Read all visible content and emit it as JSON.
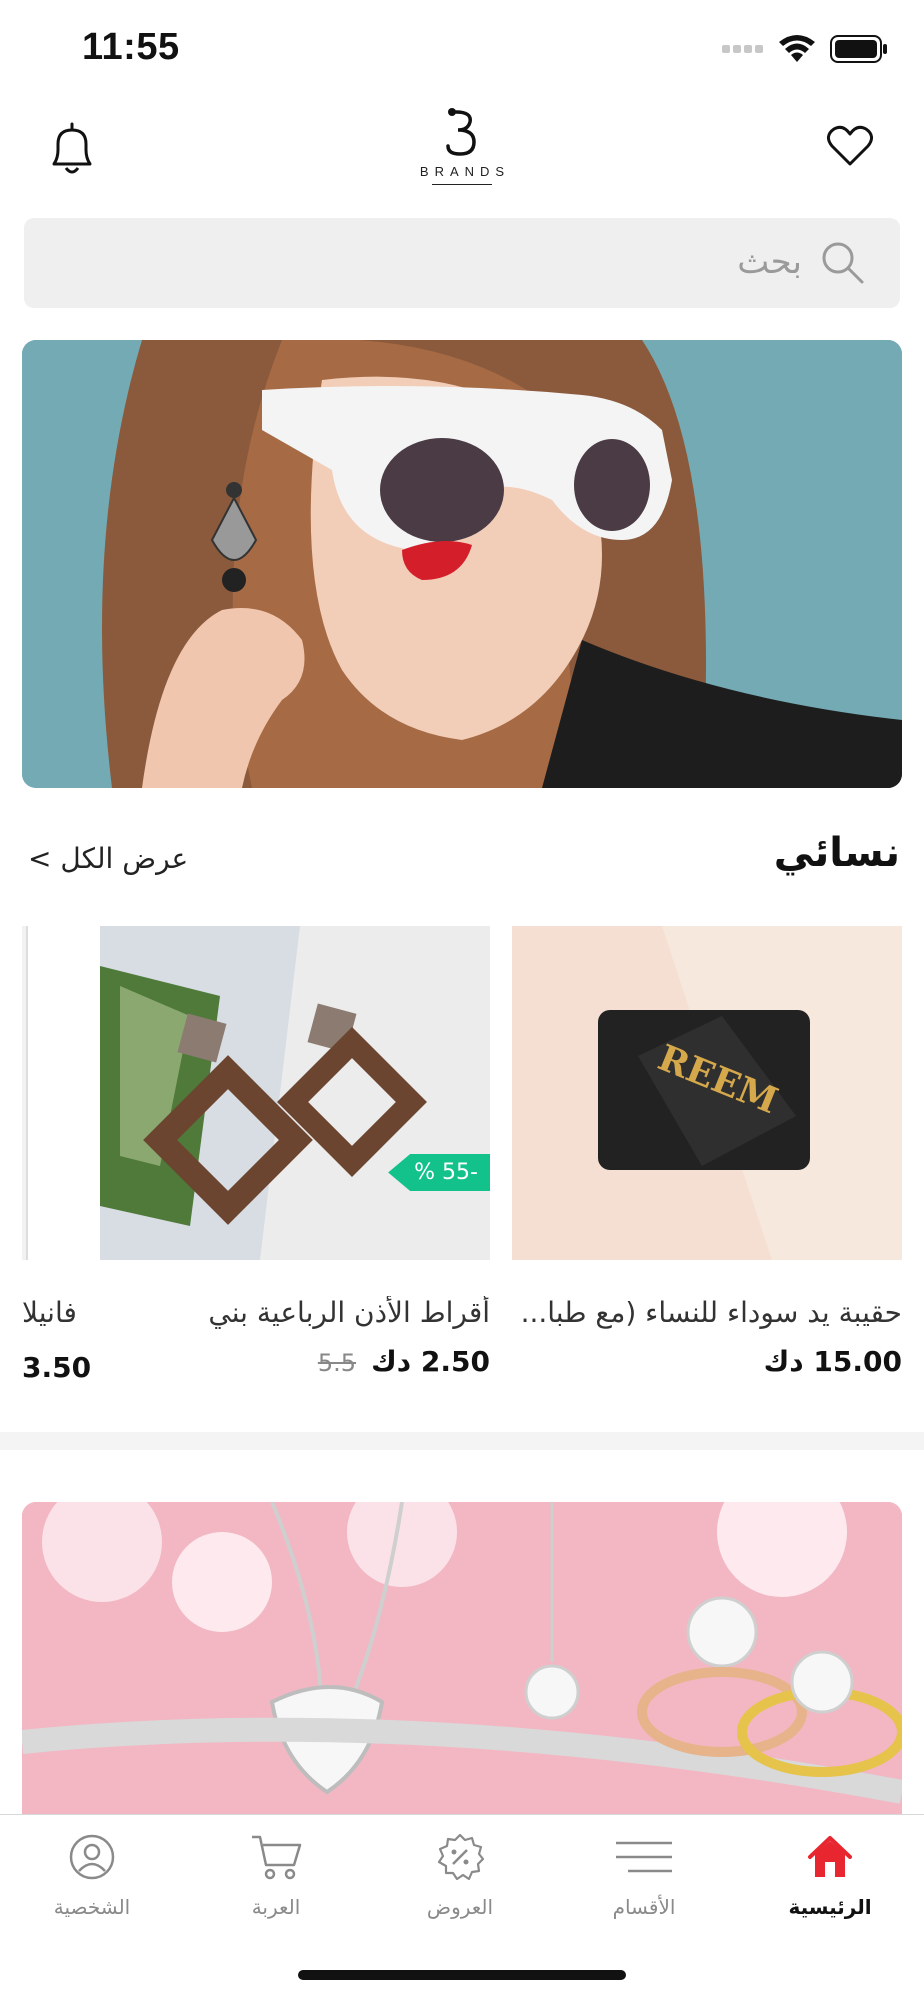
{
  "status_bar": {
    "time": "11:55"
  },
  "header": {
    "logo_text": "BRANDS",
    "bell_icon": "bell-icon",
    "favorites_icon": "heart-icon"
  },
  "search": {
    "placeholder": "بحث"
  },
  "section": {
    "title": "نسائي",
    "view_all": "عرض الكل >"
  },
  "products": [
    {
      "name": "حقيبة يد سوداء للنساء (مع طبا...",
      "price": "15.00 دك",
      "old_price": "",
      "badge": ""
    },
    {
      "name": "أقراط الأذن الرباعية بني",
      "price": "2.50 دك",
      "old_price": "5.5",
      "badge": "% 55-"
    },
    {
      "name": "فانيلا",
      "price": "3.50"
    }
  ],
  "product_image_text": "REEM",
  "bottom_nav": {
    "items": [
      {
        "label": "الشخصية",
        "icon": "profile-icon"
      },
      {
        "label": "العربة",
        "icon": "cart-icon"
      },
      {
        "label": "العروض",
        "icon": "offers-icon"
      },
      {
        "label": "الأقسام",
        "icon": "categories-icon"
      },
      {
        "label": "الرئيسية",
        "icon": "home-icon"
      }
    ],
    "active_color": "#e8262f"
  },
  "colors": {
    "discount_badge": "#12c28a",
    "search_background": "#efefef"
  }
}
